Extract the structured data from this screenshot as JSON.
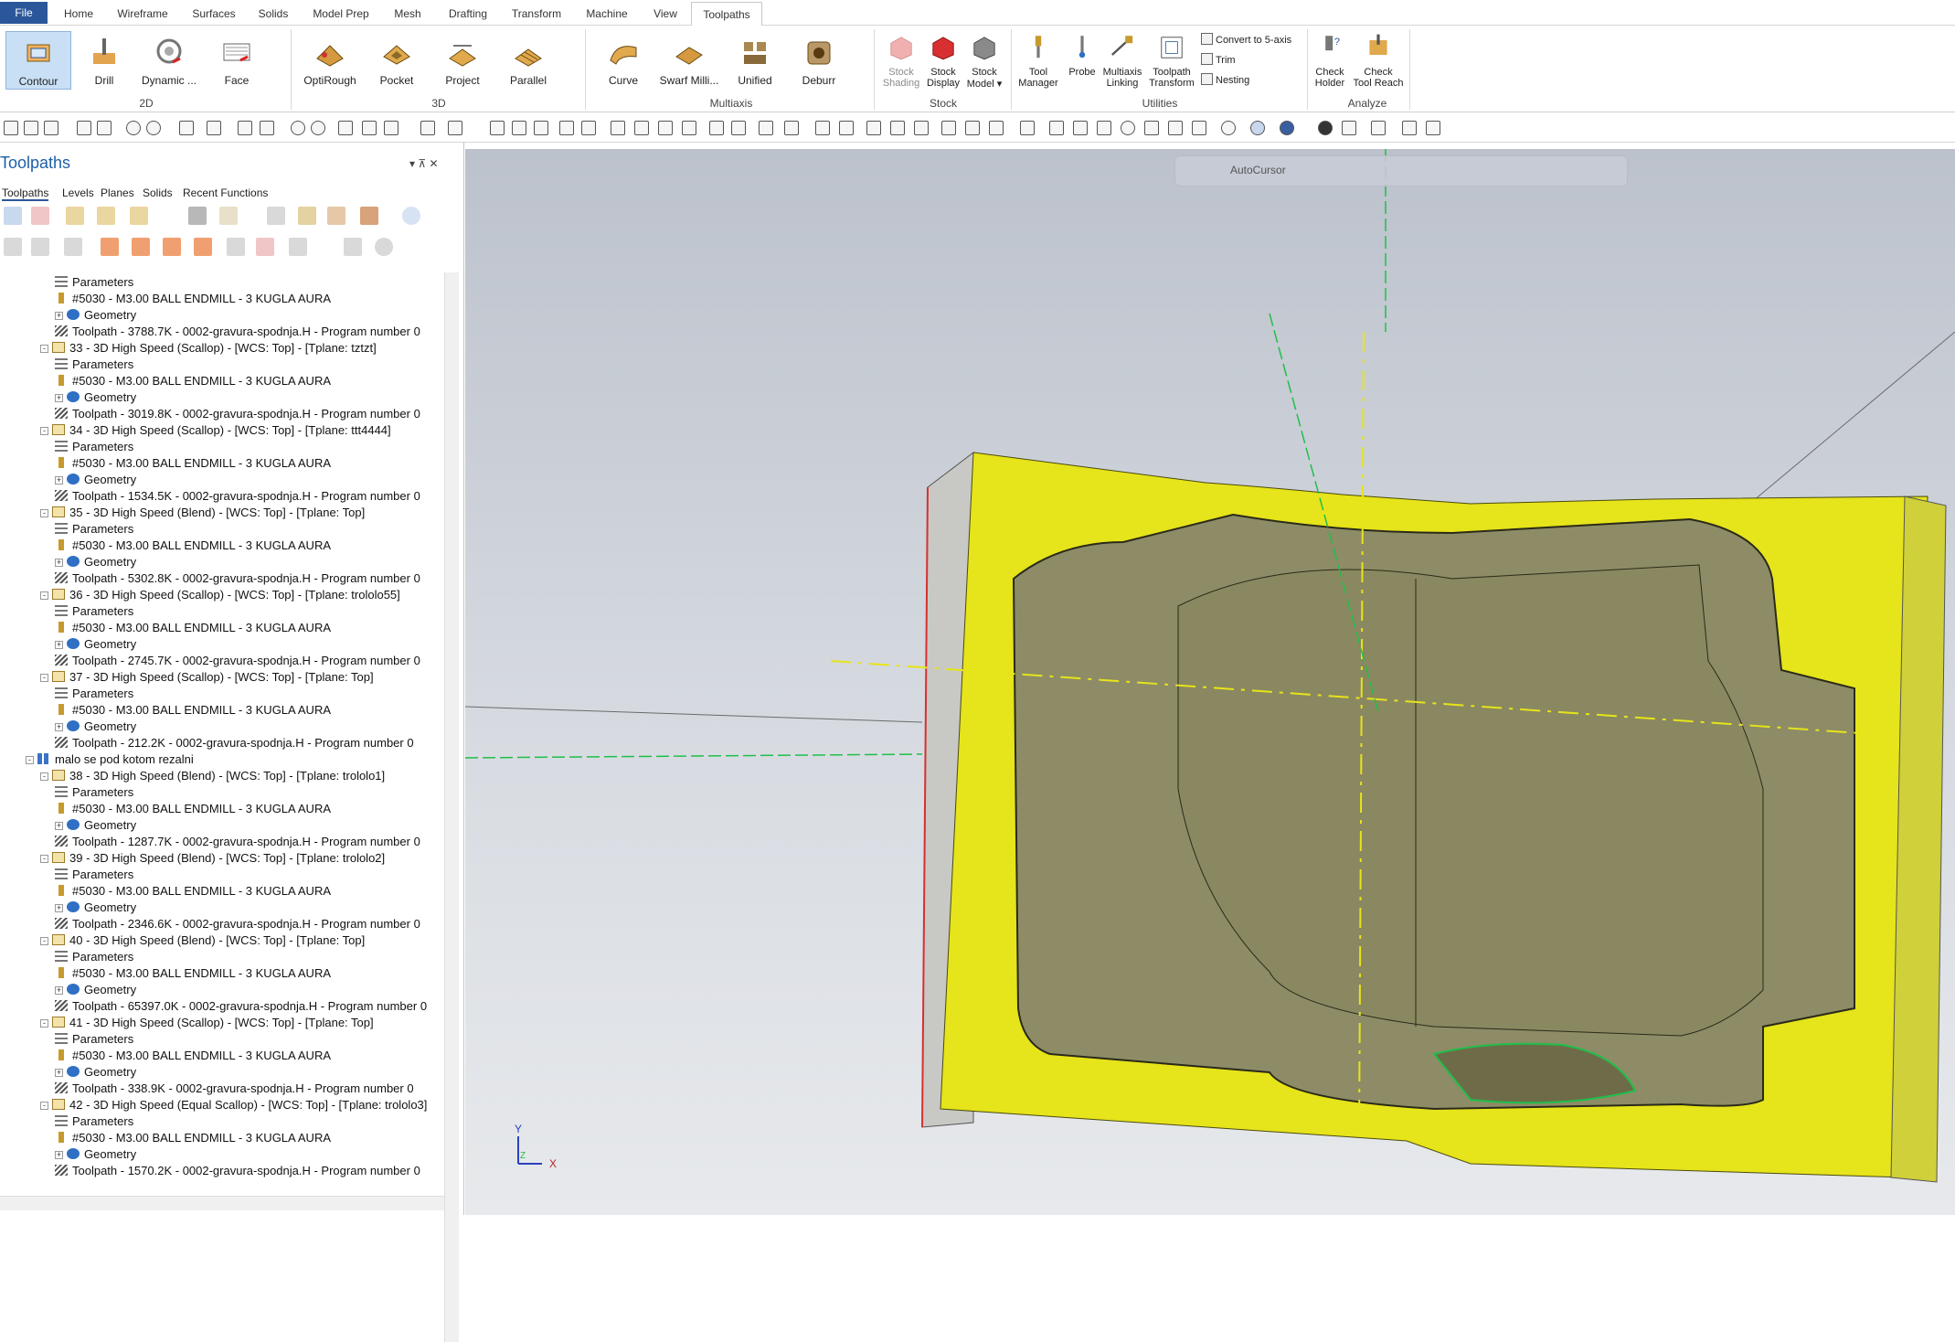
{
  "tabs": {
    "file": "File",
    "home": "Home",
    "wireframe": "Wireframe",
    "surfaces": "Surfaces",
    "solids": "Solids",
    "model_prep": "Model Prep",
    "mesh": "Mesh",
    "drafting": "Drafting",
    "transform": "Transform",
    "machine": "Machine",
    "view": "View",
    "toolpaths": "Toolpaths"
  },
  "ribbon": {
    "contour": "Contour",
    "drill": "Drill",
    "dynamic": "Dynamic ...",
    "face": "Face",
    "optirough": "OptiRough",
    "pocket": "Pocket",
    "project": "Project",
    "parallel": "Parallel",
    "curve": "Curve",
    "swarf": "Swarf Milli...",
    "unified": "Unified",
    "deburr": "Deburr",
    "stock_shading_1": "Stock",
    "stock_shading_2": "Shading",
    "stock_display_1": "Stock",
    "stock_display_2": "Display",
    "stock_model_1": "Stock",
    "stock_model_2": "Model ▾",
    "tool_manager_1": "Tool",
    "tool_manager_2": "Manager",
    "probe": "Probe",
    "multiaxis_linking_1": "Multiaxis",
    "multiaxis_linking_2": "Linking",
    "toolpath_transform_1": "Toolpath",
    "toolpath_transform_2": "Transform",
    "convert": "Convert to 5-axis",
    "trim": "Trim",
    "nesting": "Nesting",
    "check_holder_1": "Check",
    "check_holder_2": "Holder",
    "check_reach_1": "Check",
    "check_reach_2": "Tool Reach",
    "groups": {
      "g2d": "2D",
      "g3d": "3D",
      "multiaxis": "Multiaxis",
      "stock": "Stock",
      "utilities": "Utilities",
      "analyze": "Analyze"
    }
  },
  "panel": {
    "title": "Toolpaths",
    "pin": "▾ ⊼ ✕",
    "tabs": [
      "Toolpaths",
      "Levels",
      "Planes",
      "Solids",
      "Recent Functions"
    ]
  },
  "tree": [
    {
      "indent": 1,
      "icon": "par",
      "text": "Parameters"
    },
    {
      "indent": 1,
      "icon": "tool",
      "text": "#5030 - M3.00 BALL ENDMILL - 3 KUGLA AURA"
    },
    {
      "indent": 1,
      "icon": "geo",
      "text": "Geometry",
      "exp": "+"
    },
    {
      "indent": 1,
      "icon": "tp",
      "text": "Toolpath - 3788.7K - 0002-gravura-spodnja.H - Program number 0"
    },
    {
      "indent": 0,
      "icon": "op",
      "text": "33 - 3D High Speed (Scallop) - [WCS: Top] - [Tplane: tztzt]",
      "exp": "−"
    },
    {
      "indent": 1,
      "icon": "par",
      "text": "Parameters"
    },
    {
      "indent": 1,
      "icon": "tool",
      "text": "#5030 - M3.00 BALL ENDMILL - 3 KUGLA AURA"
    },
    {
      "indent": 1,
      "icon": "geo",
      "text": "Geometry",
      "exp": "+"
    },
    {
      "indent": 1,
      "icon": "tp",
      "text": "Toolpath - 3019.8K - 0002-gravura-spodnja.H - Program number 0"
    },
    {
      "indent": 0,
      "icon": "op",
      "text": "34 - 3D High Speed (Scallop) - [WCS: Top] - [Tplane: ttt4444]",
      "exp": "−"
    },
    {
      "indent": 1,
      "icon": "par",
      "text": "Parameters"
    },
    {
      "indent": 1,
      "icon": "tool",
      "text": "#5030 - M3.00 BALL ENDMILL - 3 KUGLA AURA"
    },
    {
      "indent": 1,
      "icon": "geo",
      "text": "Geometry",
      "exp": "+"
    },
    {
      "indent": 1,
      "icon": "tp",
      "text": "Toolpath - 1534.5K - 0002-gravura-spodnja.H - Program number 0"
    },
    {
      "indent": 0,
      "icon": "op",
      "text": "35 - 3D High Speed (Blend) - [WCS: Top] - [Tplane: Top]",
      "exp": "−"
    },
    {
      "indent": 1,
      "icon": "par",
      "text": "Parameters"
    },
    {
      "indent": 1,
      "icon": "tool",
      "text": "#5030 - M3.00 BALL ENDMILL - 3 KUGLA AURA"
    },
    {
      "indent": 1,
      "icon": "geo",
      "text": "Geometry",
      "exp": "+"
    },
    {
      "indent": 1,
      "icon": "tp",
      "text": "Toolpath - 5302.8K - 0002-gravura-spodnja.H - Program number 0"
    },
    {
      "indent": 0,
      "icon": "op",
      "text": "36 - 3D High Speed (Scallop) - [WCS: Top] - [Tplane: trololo55]",
      "exp": "−"
    },
    {
      "indent": 1,
      "icon": "par",
      "text": "Parameters"
    },
    {
      "indent": 1,
      "icon": "tool",
      "text": "#5030 - M3.00 BALL ENDMILL - 3 KUGLA AURA"
    },
    {
      "indent": 1,
      "icon": "geo",
      "text": "Geometry",
      "exp": "+"
    },
    {
      "indent": 1,
      "icon": "tp",
      "text": "Toolpath - 2745.7K - 0002-gravura-spodnja.H - Program number 0"
    },
    {
      "indent": 0,
      "icon": "op",
      "text": "37 - 3D High Speed (Scallop) - [WCS: Top] - [Tplane: Top]",
      "exp": "−"
    },
    {
      "indent": 1,
      "icon": "par",
      "text": "Parameters"
    },
    {
      "indent": 1,
      "icon": "tool",
      "text": "#5030 - M3.00 BALL ENDMILL - 3 KUGLA AURA"
    },
    {
      "indent": 1,
      "icon": "geo",
      "text": "Geometry",
      "exp": "+"
    },
    {
      "indent": 1,
      "icon": "tp",
      "text": "Toolpath - 212.2K - 0002-gravura-spodnja.H - Program number 0"
    },
    {
      "indent": -1,
      "icon": "grpico",
      "text": "malo se pod kotom rezalni",
      "exp": "−"
    },
    {
      "indent": 0,
      "icon": "op",
      "text": "38 - 3D High Speed (Blend) - [WCS: Top] - [Tplane: trololo1]",
      "exp": "−"
    },
    {
      "indent": 1,
      "icon": "par",
      "text": "Parameters"
    },
    {
      "indent": 1,
      "icon": "tool",
      "text": "#5030 - M3.00 BALL ENDMILL - 3 KUGLA AURA"
    },
    {
      "indent": 1,
      "icon": "geo",
      "text": "Geometry",
      "exp": "+"
    },
    {
      "indent": 1,
      "icon": "tp",
      "text": "Toolpath - 1287.7K - 0002-gravura-spodnja.H - Program number 0"
    },
    {
      "indent": 0,
      "icon": "op",
      "text": "39 - 3D High Speed (Blend) - [WCS: Top] - [Tplane: trololo2]",
      "exp": "−"
    },
    {
      "indent": 1,
      "icon": "par",
      "text": "Parameters"
    },
    {
      "indent": 1,
      "icon": "tool",
      "text": "#5030 - M3.00 BALL ENDMILL - 3 KUGLA AURA"
    },
    {
      "indent": 1,
      "icon": "geo",
      "text": "Geometry",
      "exp": "+"
    },
    {
      "indent": 1,
      "icon": "tp",
      "text": "Toolpath - 2346.6K - 0002-gravura-spodnja.H - Program number 0"
    },
    {
      "indent": 0,
      "icon": "op",
      "text": "40 - 3D High Speed (Blend) - [WCS: Top] - [Tplane: Top]",
      "exp": "−"
    },
    {
      "indent": 1,
      "icon": "par",
      "text": "Parameters"
    },
    {
      "indent": 1,
      "icon": "tool",
      "text": "#5030 - M3.00 BALL ENDMILL - 3 KUGLA AURA"
    },
    {
      "indent": 1,
      "icon": "geo",
      "text": "Geometry",
      "exp": "+"
    },
    {
      "indent": 1,
      "icon": "tp",
      "text": "Toolpath - 65397.0K - 0002-gravura-spodnja.H - Program number 0"
    },
    {
      "indent": 0,
      "icon": "op",
      "text": "41 - 3D High Speed (Scallop) - [WCS: Top] - [Tplane: Top]",
      "exp": "−"
    },
    {
      "indent": 1,
      "icon": "par",
      "text": "Parameters"
    },
    {
      "indent": 1,
      "icon": "tool",
      "text": "#5030 - M3.00 BALL ENDMILL - 3 KUGLA AURA"
    },
    {
      "indent": 1,
      "icon": "geo",
      "text": "Geometry",
      "exp": "+"
    },
    {
      "indent": 1,
      "icon": "tp",
      "text": "Toolpath - 338.9K - 0002-gravura-spodnja.H - Program number 0"
    },
    {
      "indent": 0,
      "icon": "op",
      "text": "42 - 3D High Speed (Equal Scallop) - [WCS: Top] - [Tplane: trololo3]",
      "exp": "−"
    },
    {
      "indent": 1,
      "icon": "par",
      "text": "Parameters"
    },
    {
      "indent": 1,
      "icon": "tool",
      "text": "#5030 - M3.00 BALL ENDMILL - 3 KUGLA AURA"
    },
    {
      "indent": 1,
      "icon": "geo",
      "text": "Geometry",
      "exp": "+"
    },
    {
      "indent": 1,
      "icon": "tp",
      "text": "Toolpath - 1570.2K - 0002-gravura-spodnja.H - Program number 0"
    }
  ],
  "viewport": {
    "autocursor": "AutoCursor",
    "axis_x": "X",
    "axis_y": "Y",
    "axis_z": "Z"
  },
  "colors": {
    "accent": "#2b579a",
    "part_yellow": "#e6e41a",
    "cavity": "#8d8c66"
  }
}
